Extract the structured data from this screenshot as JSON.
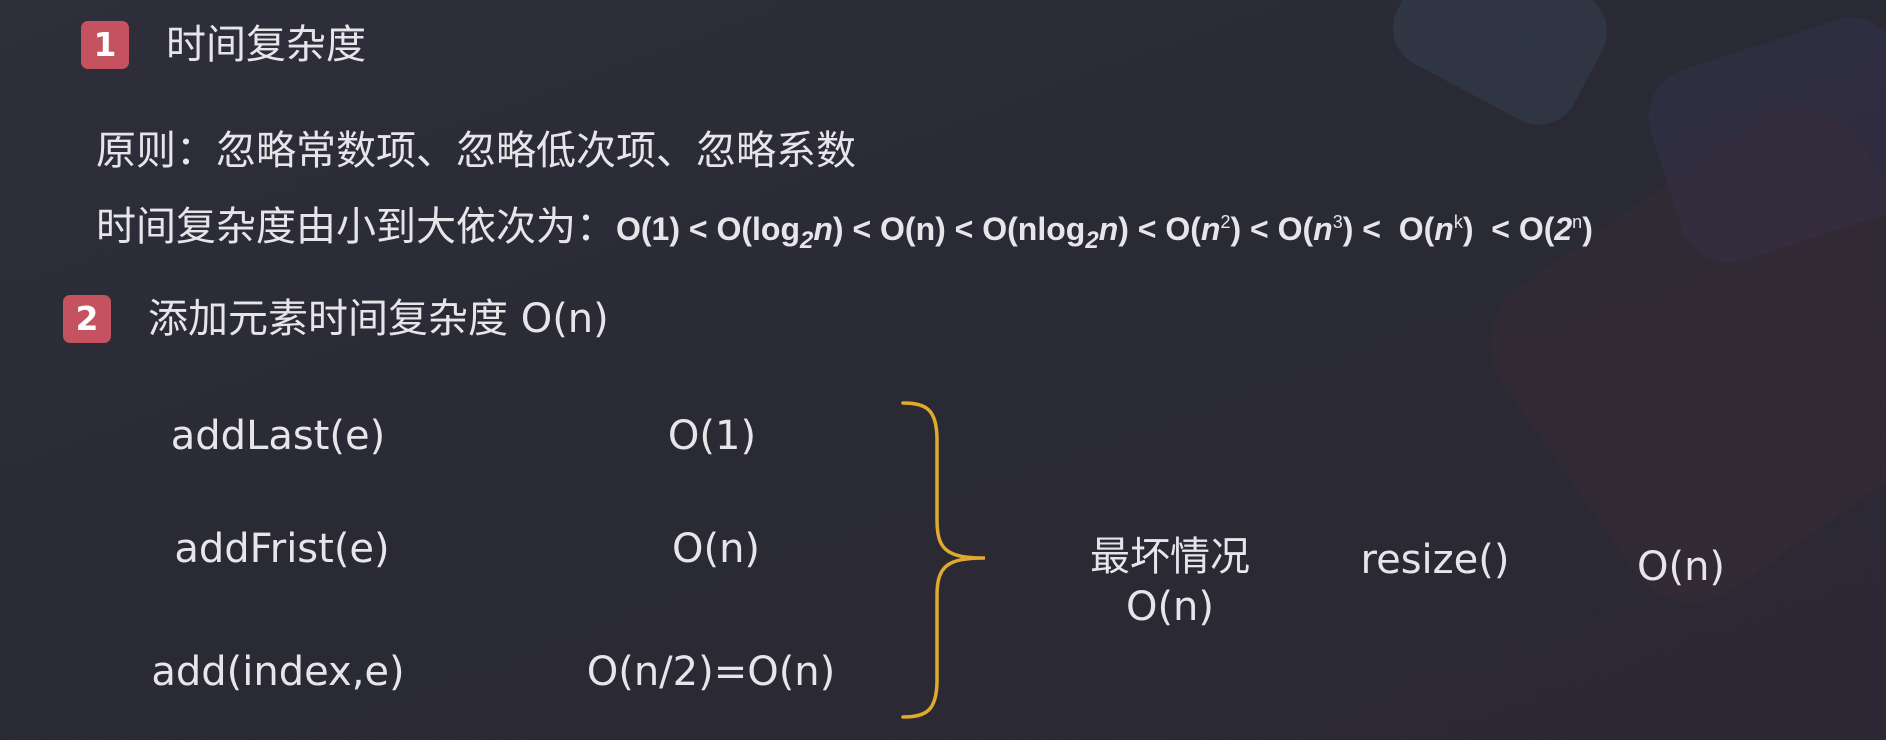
{
  "section1": {
    "number": "1",
    "title": "时间复杂度",
    "principle": "原则：忽略常数项、忽略低次项、忽略系数",
    "order_prefix": "时间复杂度由小到大依次为：",
    "order": {
      "o1": "O(1)",
      "lt": "<",
      "log_pre": "O(log",
      "log_sub": "2",
      "n": "n",
      "close": ")",
      "on": "O(n)",
      "nlog_pre": "O(nlog",
      "o_open": "O(",
      "sq": "2",
      "cube": "3",
      "k": "k",
      "exp_base": "2",
      "exp": "n"
    }
  },
  "section2": {
    "number": "2",
    "title": "添加元素时间复杂度 O(n)",
    "rows": [
      {
        "op": "addLast(e)",
        "complexity": "O(1)"
      },
      {
        "op": "addFrist(e)",
        "complexity": "O(n)"
      },
      {
        "op": "add(index,e)",
        "complexity": "O(n/2)=O(n)"
      }
    ],
    "worst_label": "最坏情况",
    "worst_value": "O(n)",
    "resize_label": "resize()",
    "resize_value": "O(n)"
  },
  "colors": {
    "background": "#2c2c37",
    "badge": "#c4525f",
    "brace": "#e0aa2c",
    "text": "#e6e6ea"
  }
}
